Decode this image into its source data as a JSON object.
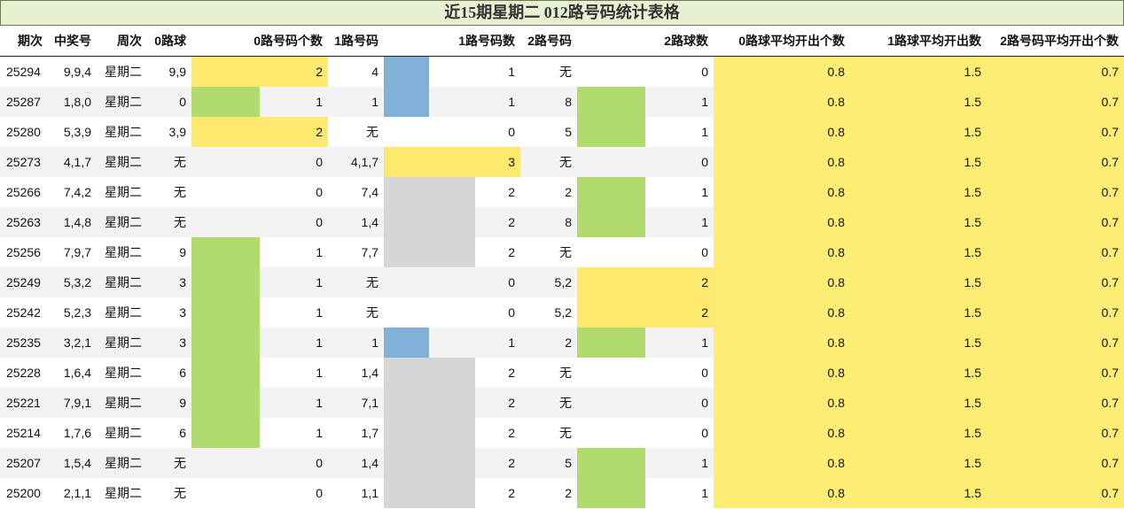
{
  "title": "近15期星期二 012路号码统计表格",
  "headers": [
    "期次",
    "中奖号",
    "周次",
    "0路球",
    "0路号码个数",
    "1路号码",
    "1路号码数",
    "2路号码",
    "2路球数",
    "0路球平均开出个数",
    "1路球平均开出数",
    "2路号码平均开出个数"
  ],
  "rows": [
    {
      "qici": "25294",
      "num": "9,9,4",
      "week": "星期二",
      "r0": "9,9",
      "r0c": "2",
      "r1": "4",
      "r1c": "1",
      "r2": "无",
      "r2c": "0",
      "a0": "0.8",
      "a1": "1.5",
      "a2": "0.7"
    },
    {
      "qici": "25287",
      "num": "1,8,0",
      "week": "星期二",
      "r0": "0",
      "r0c": "1",
      "r1": "1",
      "r1c": "1",
      "r2": "8",
      "r2c": "1",
      "a0": "0.8",
      "a1": "1.5",
      "a2": "0.7"
    },
    {
      "qici": "25280",
      "num": "5,3,9",
      "week": "星期二",
      "r0": "3,9",
      "r0c": "2",
      "r1": "无",
      "r1c": "0",
      "r2": "5",
      "r2c": "1",
      "a0": "0.8",
      "a1": "1.5",
      "a2": "0.7"
    },
    {
      "qici": "25273",
      "num": "4,1,7",
      "week": "星期二",
      "r0": "无",
      "r0c": "0",
      "r1": "4,1,7",
      "r1c": "3",
      "r2": "无",
      "r2c": "0",
      "a0": "0.8",
      "a1": "1.5",
      "a2": "0.7"
    },
    {
      "qici": "25266",
      "num": "7,4,2",
      "week": "星期二",
      "r0": "无",
      "r0c": "0",
      "r1": "7,4",
      "r1c": "2",
      "r2": "2",
      "r2c": "1",
      "a0": "0.8",
      "a1": "1.5",
      "a2": "0.7"
    },
    {
      "qici": "25263",
      "num": "1,4,8",
      "week": "星期二",
      "r0": "无",
      "r0c": "0",
      "r1": "1,4",
      "r1c": "2",
      "r2": "8",
      "r2c": "1",
      "a0": "0.8",
      "a1": "1.5",
      "a2": "0.7"
    },
    {
      "qici": "25256",
      "num": "7,9,7",
      "week": "星期二",
      "r0": "9",
      "r0c": "1",
      "r1": "7,7",
      "r1c": "2",
      "r2": "无",
      "r2c": "0",
      "a0": "0.8",
      "a1": "1.5",
      "a2": "0.7"
    },
    {
      "qici": "25249",
      "num": "5,3,2",
      "week": "星期二",
      "r0": "3",
      "r0c": "1",
      "r1": "无",
      "r1c": "0",
      "r2": "5,2",
      "r2c": "2",
      "a0": "0.8",
      "a1": "1.5",
      "a2": "0.7"
    },
    {
      "qici": "25242",
      "num": "5,2,3",
      "week": "星期二",
      "r0": "3",
      "r0c": "1",
      "r1": "无",
      "r1c": "0",
      "r2": "5,2",
      "r2c": "2",
      "a0": "0.8",
      "a1": "1.5",
      "a2": "0.7"
    },
    {
      "qici": "25235",
      "num": "3,2,1",
      "week": "星期二",
      "r0": "3",
      "r0c": "1",
      "r1": "1",
      "r1c": "1",
      "r2": "2",
      "r2c": "1",
      "a0": "0.8",
      "a1": "1.5",
      "a2": "0.7"
    },
    {
      "qici": "25228",
      "num": "1,6,4",
      "week": "星期二",
      "r0": "6",
      "r0c": "1",
      "r1": "1,4",
      "r1c": "2",
      "r2": "无",
      "r2c": "0",
      "a0": "0.8",
      "a1": "1.5",
      "a2": "0.7"
    },
    {
      "qici": "25221",
      "num": "7,9,1",
      "week": "星期二",
      "r0": "9",
      "r0c": "1",
      "r1": "7,1",
      "r1c": "2",
      "r2": "无",
      "r2c": "0",
      "a0": "0.8",
      "a1": "1.5",
      "a2": "0.7"
    },
    {
      "qici": "25214",
      "num": "1,7,6",
      "week": "星期二",
      "r0": "6",
      "r0c": "1",
      "r1": "1,7",
      "r1c": "2",
      "r2": "无",
      "r2c": "0",
      "a0": "0.8",
      "a1": "1.5",
      "a2": "0.7"
    },
    {
      "qici": "25207",
      "num": "1,5,4",
      "week": "星期二",
      "r0": "无",
      "r0c": "0",
      "r1": "1,4",
      "r1c": "2",
      "r2": "5",
      "r2c": "1",
      "a0": "0.8",
      "a1": "1.5",
      "a2": "0.7"
    },
    {
      "qici": "25200",
      "num": "2,1,1",
      "week": "星期二",
      "r0": "无",
      "r0c": "0",
      "r1": "1,1",
      "r1c": "2",
      "r2": "2",
      "r2c": "1",
      "a0": "0.8",
      "a1": "1.5",
      "a2": "0.7"
    }
  ],
  "colors": {
    "count1": "#b1db6c",
    "count2": "#fde96f",
    "r1_count1": "#7fb2d6",
    "r1_count2": "#d6d6d6",
    "r1_count3": "#fde96f",
    "average": "#fded74"
  }
}
